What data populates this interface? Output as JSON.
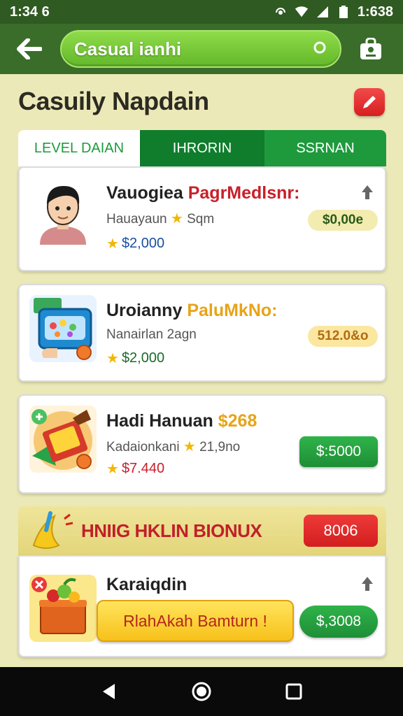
{
  "status_bar": {
    "time": "1:34 6",
    "clock_right": "1:638"
  },
  "app_bar": {
    "search_text": "Casual ianhi"
  },
  "page_title": "Casuily Napdain",
  "tabs": [
    {
      "label": "LEVEL DAIAN"
    },
    {
      "label": "IHRORIN"
    },
    {
      "label": "SSRNAN"
    }
  ],
  "cards": [
    {
      "title": "Vauogiea",
      "title_accent": "PagrMedlsnr:",
      "subtitle": "Hauayaun",
      "subtitle_tail": "Sqm",
      "price": "$2,000",
      "pill": "$0,00e",
      "accent_color": "#c8202a"
    },
    {
      "title": "Uroianny",
      "title_accent": "PaluMkNo:",
      "subtitle": "Nanairlan 2agn",
      "price": "$2,000",
      "pill": "512.0&o",
      "accent_color": "#e8a317"
    },
    {
      "title": "Hadi Hanuan",
      "title_accent": "$268",
      "subtitle": "Kadaionkani",
      "subtitle_tail": "21,9no",
      "price": "$7.440",
      "button": "$:5000",
      "accent_color": "#e8a317"
    }
  ],
  "bonus": {
    "title": "HNIIG HKLIN BIONUX",
    "badge": "8006",
    "item": {
      "title": "Karaiqdin",
      "action": "RlahAkah Bamturn !",
      "button": "$,3008"
    }
  }
}
